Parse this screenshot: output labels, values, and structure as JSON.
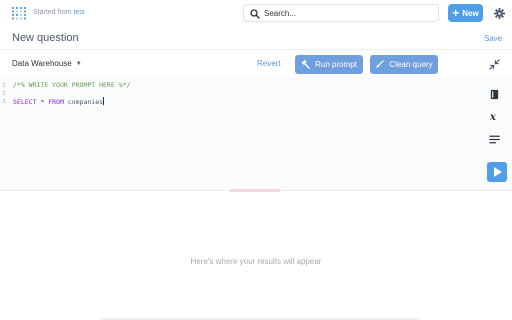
{
  "header": {
    "breadcrumb_prefix": "Started from",
    "breadcrumb_link": "test",
    "search_placeholder": "Search...",
    "new_label": "New"
  },
  "question": {
    "title": "New question",
    "save_label": "Save"
  },
  "editor_toolbar": {
    "database": "Data Warehouse",
    "revert_label": "Revert",
    "run_prompt_label": "Run prompt",
    "clean_query_label": "Clean query"
  },
  "editor": {
    "line_numbers": [
      "1",
      "2",
      "3"
    ],
    "line1": "/*% WRITE YOUR PROMPT HERE %*/",
    "line3_kw1": "SELECT",
    "line3_mid": " * ",
    "line3_kw2": "FROM",
    "line3_rest": " companies"
  },
  "results": {
    "empty_message": "Here's where your results will appear"
  },
  "colors": {
    "brand": "#509ee3",
    "button": "#6f9fdc"
  }
}
